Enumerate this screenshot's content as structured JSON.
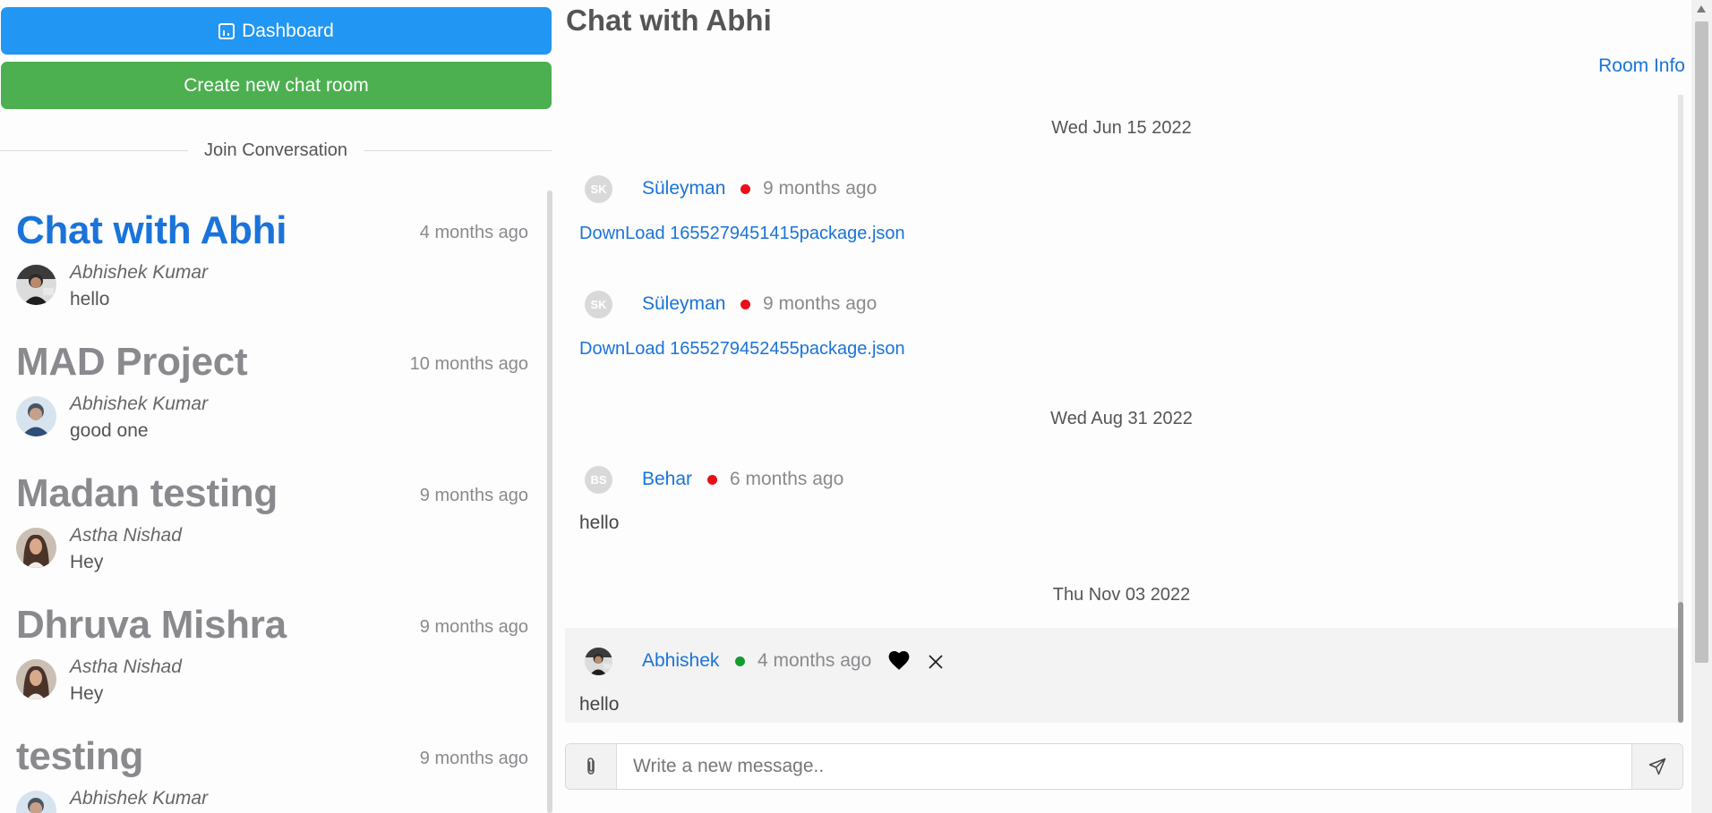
{
  "sidebar": {
    "dashboard_label": "Dashboard",
    "create_room_label": "Create new chat room",
    "join_label": "Join Conversation",
    "rooms": [
      {
        "title": "Chat with Abhi",
        "time": "4 months ago",
        "author": "Abhishek Kumar",
        "message": "hello",
        "active": true
      },
      {
        "title": "MAD Project",
        "time": "10 months ago",
        "author": "Abhishek Kumar",
        "message": "good one",
        "active": false
      },
      {
        "title": "Madan testing",
        "time": "9 months ago",
        "author": "Astha Nishad",
        "message": "Hey",
        "active": false
      },
      {
        "title": "Dhruva Mishra",
        "time": "9 months ago",
        "author": "Astha Nishad",
        "message": "Hey",
        "active": false
      },
      {
        "title": "testing",
        "time": "9 months ago",
        "author": "Abhishek Kumar",
        "message": "",
        "active": false
      }
    ]
  },
  "chat": {
    "title": "Chat with Abhi",
    "room_info_label": "Room Info",
    "dates": [
      "Wed Jun 15 2022",
      "Wed Aug 31 2022",
      "Thu Nov 03 2022"
    ],
    "messages": [
      {
        "initials": "SK",
        "sender": "Süleyman",
        "status": "offline",
        "ago": "9 months ago",
        "download": "DownLoad 1655279451415package.json"
      },
      {
        "initials": "SK",
        "sender": "Süleyman",
        "status": "offline",
        "ago": "9 months ago",
        "download": "DownLoad 1655279452455package.json"
      },
      {
        "initials": "BS",
        "sender": "Behar",
        "status": "offline",
        "ago": "6 months ago",
        "text": "hello"
      },
      {
        "sender": "Abhishek",
        "status": "online",
        "ago": "4 months ago",
        "text": "hello"
      }
    ],
    "composer": {
      "placeholder": "Write a new message.."
    }
  },
  "colors": {
    "primary": "#2196f3",
    "success": "#4caf50",
    "link": "#1a73d9",
    "offline": "#e8101a",
    "online": "#159b2e"
  }
}
